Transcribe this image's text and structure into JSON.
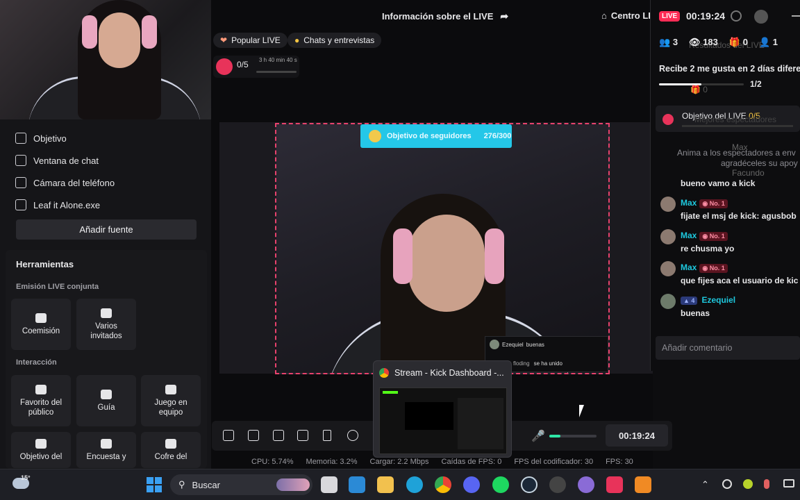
{
  "left": {
    "sources": [
      {
        "label": "Objetivo",
        "icon": "shield-icon"
      },
      {
        "label": "Ventana de chat",
        "icon": "chat-icon"
      },
      {
        "label": "Cámara del teléfono",
        "icon": "camera-icon"
      },
      {
        "label": "Leaf it Alone.exe",
        "icon": "window-icon"
      }
    ],
    "add_source": "Añadir fuente",
    "tools_title": "Herramientas",
    "section_joint": "Emisión LIVE conjunta",
    "tools_joint": [
      {
        "label": "Coemisión",
        "icon": "link-icon"
      },
      {
        "label": "Varios invitados",
        "icon": "users-icon"
      }
    ],
    "section_interaction": "Interacción",
    "tools_interaction": [
      {
        "label": "Favorito del público",
        "icon": "star-user-icon"
      },
      {
        "label": "Guía",
        "icon": "guide-icon"
      },
      {
        "label": "Juego en equipo",
        "icon": "team-icon"
      },
      {
        "label": "Objetivo del",
        "icon": "target-icon"
      },
      {
        "label": "Encuesta y",
        "icon": "poll-icon"
      },
      {
        "label": "Cofre del",
        "icon": "chest-icon"
      }
    ]
  },
  "center": {
    "title": "Información sobre el LIVE",
    "centro_live": "Centro LIVE",
    "pills": [
      {
        "label": "Popular LIVE",
        "icon": "heart-icon"
      },
      {
        "label": "Chats y entrevistas",
        "icon": "chat-bubble-icon"
      }
    ],
    "goal_count": "0/5",
    "goal_time": "3 h 40 min 40 s",
    "follow_goal_label": "Objetivo de seguidores",
    "follow_goal_value": "276/300",
    "overlay_chat": [
      {
        "user": "Ezequiel",
        "text": "buenas"
      },
      {
        "user": "floding",
        "text": "se ha unido"
      }
    ],
    "timer": "00:19:24",
    "stats": {
      "cpu": "CPU: 5.74%",
      "mem": "Memoria: 3.2%",
      "load": "Cargar: 2.2 Mbps",
      "drops": "Caídas de FPS: 0",
      "enc": "FPS del codificador: 30",
      "fps": "FPS: 30"
    },
    "thumb_title": "Stream - Kick Dashboard -..."
  },
  "right": {
    "live_badge": "LIVE",
    "live_timer": "00:19:24",
    "counts": [
      {
        "icon": "people-icon",
        "value": "3"
      },
      {
        "icon": "eye-icon",
        "value": "183"
      },
      {
        "icon": "gift-icon",
        "value": "0"
      },
      {
        "icon": "person-plus-icon",
        "value": "1"
      }
    ],
    "resumen": "Resultados del LIVE",
    "task": "Recibe 2 me gusta en 2 días difere",
    "task_progress": "1/2",
    "task_fraction": 0.5,
    "gift_zero": "0",
    "objective_label": "Objetivo del LIVE",
    "objective_value": "0/5",
    "best_viewers": "Mejores espectadores",
    "ghost_max": "Max",
    "ghost_facundo": "Facundo",
    "anima": "Anima a los espectadores a env",
    "anima2": "agradéceles su apoy",
    "messages": [
      {
        "user": "",
        "text": "bueno vamo a kick",
        "badge": ""
      },
      {
        "user": "Max",
        "badge": "No. 1",
        "text": "fijate el msj de kick: agusbob"
      },
      {
        "user": "Max",
        "badge": "No. 1",
        "text": "re chusma yo"
      },
      {
        "user": "Max",
        "badge": "No. 1",
        "text": "que fijes aca el usuario de kic"
      },
      {
        "user": "Ezequiel",
        "badge": "4",
        "text": "buenas"
      }
    ],
    "comment_placeholder": "Añadir comentario"
  },
  "taskbar": {
    "weather": "15°",
    "search": "Buscar"
  },
  "colors": {
    "accent_pink": "#e8426d",
    "cyan": "#1ec8de",
    "live": "#fe2c55"
  }
}
